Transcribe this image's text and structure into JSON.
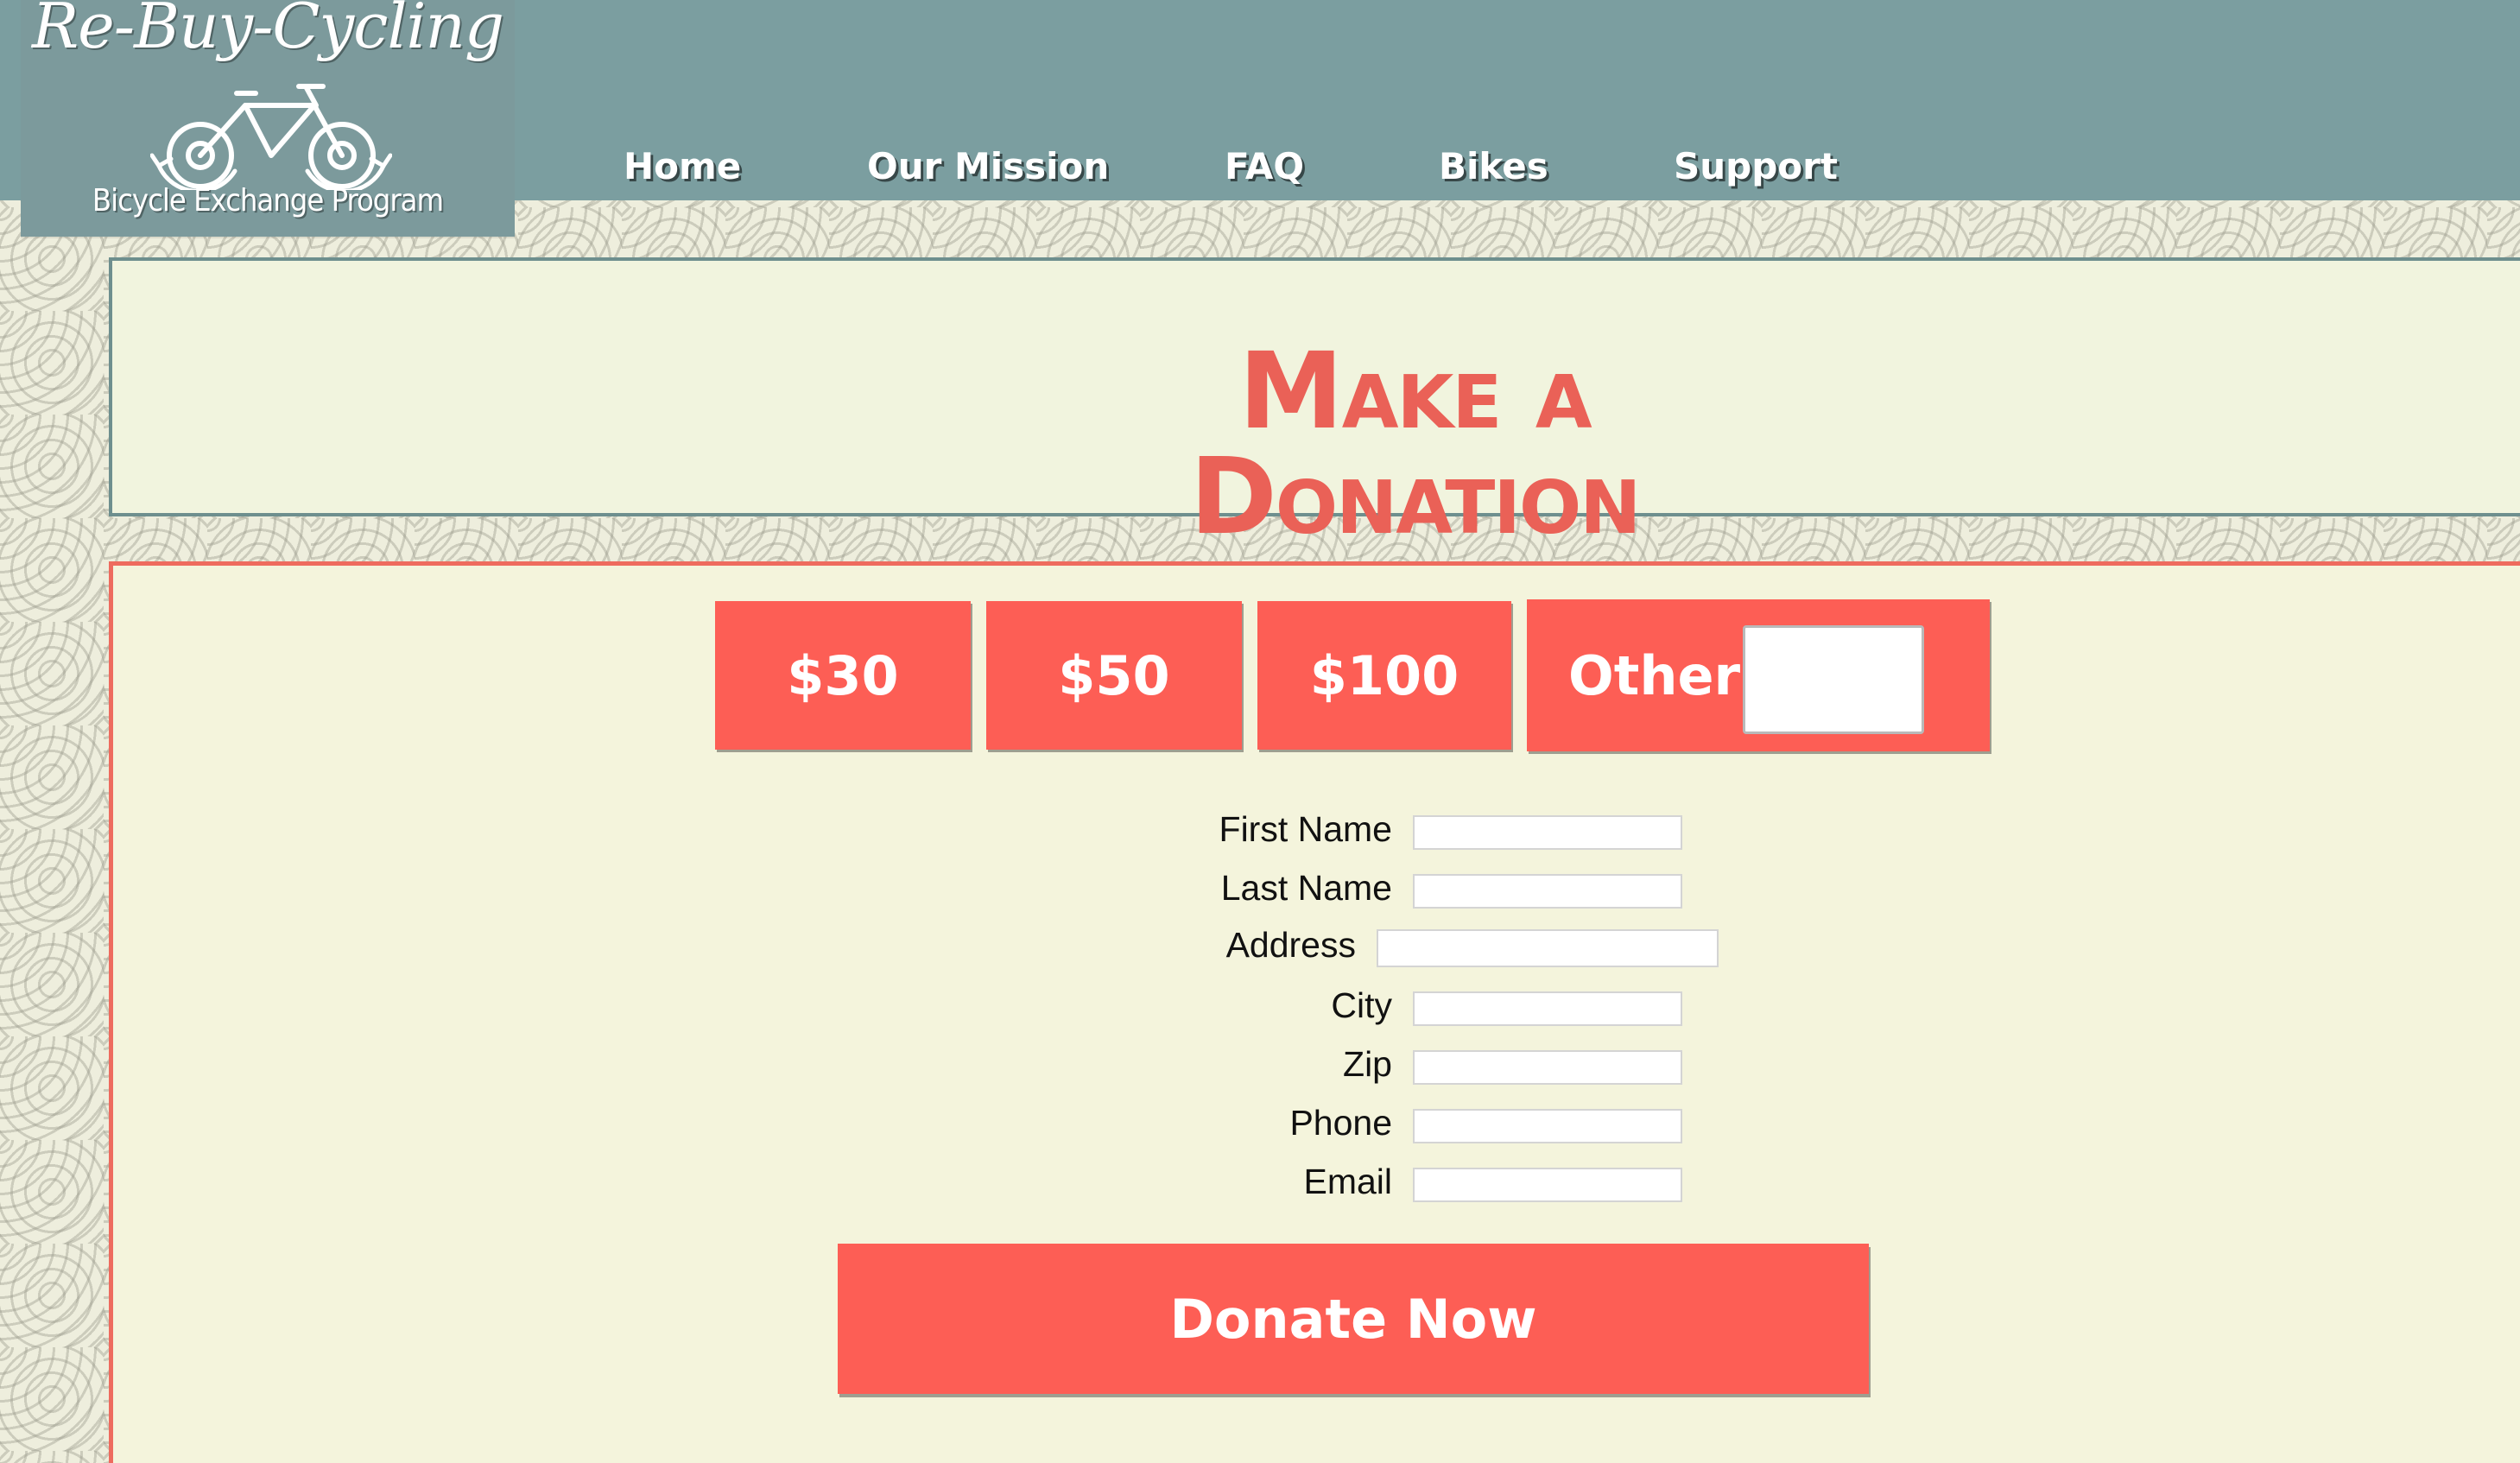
{
  "logo": {
    "script_text": "Re-Buy-Cycling",
    "subtitle": "Bicycle Exchange Program"
  },
  "nav": {
    "items": [
      {
        "label": "Home"
      },
      {
        "label": "Our Mission"
      },
      {
        "label": "FAQ"
      },
      {
        "label": "Bikes"
      },
      {
        "label": "Support"
      }
    ]
  },
  "title": "Make a Donation",
  "amounts": {
    "options": [
      "$30",
      "$50",
      "$100"
    ],
    "other_label": "Other",
    "other_value": ""
  },
  "form": {
    "fields": [
      {
        "label": "First Name",
        "value": ""
      },
      {
        "label": "Last Name",
        "value": ""
      },
      {
        "label": "Address",
        "value": ""
      },
      {
        "label": "City",
        "value": ""
      },
      {
        "label": "Zip",
        "value": ""
      },
      {
        "label": "Phone",
        "value": ""
      },
      {
        "label": "Email",
        "value": ""
      }
    ],
    "submit_label": "Donate Now"
  },
  "colors": {
    "header": "#7b9ea0",
    "accent": "#fd5e55",
    "title": "#ea6157",
    "panel": "#f4f4dc"
  },
  "icons": [
    "bicycle-icon",
    "recycle-arrows-icon"
  ]
}
